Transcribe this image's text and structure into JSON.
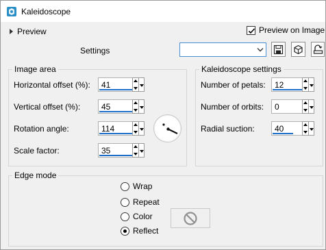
{
  "window": {
    "title": "Kaleidoscope"
  },
  "preview": {
    "toggle_label": "Preview",
    "on_image_label": "Preview on Image",
    "on_image_checked": true
  },
  "settings": {
    "label": "Settings",
    "value": ""
  },
  "image_area": {
    "title": "Image area",
    "horizontal_offset": {
      "label": "Horizontal offset (%):",
      "value": "41"
    },
    "vertical_offset": {
      "label": "Vertical offset (%):",
      "value": "45"
    },
    "rotation_angle": {
      "label": "Rotation angle:",
      "value": "114"
    },
    "scale_factor": {
      "label": "Scale factor:",
      "value": "35"
    }
  },
  "kaleidoscope_settings": {
    "title": "Kaleidoscope settings",
    "number_of_petals": {
      "label": "Number of petals:",
      "value": "12"
    },
    "number_of_orbits": {
      "label": "Number of orbits:",
      "value": "0"
    },
    "radial_suction": {
      "label": "Radial suction:",
      "value": "40"
    }
  },
  "edge_mode": {
    "title": "Edge mode",
    "options": [
      "Wrap",
      "Repeat",
      "Color",
      "Reflect"
    ],
    "selected": "Reflect"
  },
  "colors": {
    "accent": "#1f6fc9",
    "combo_border": "#4a8fd6",
    "app_icon": "#2b8fc7"
  },
  "icons": [
    "app-icon",
    "save-icon",
    "reset-icon",
    "settings-menu-icon",
    "no-color-icon"
  ]
}
